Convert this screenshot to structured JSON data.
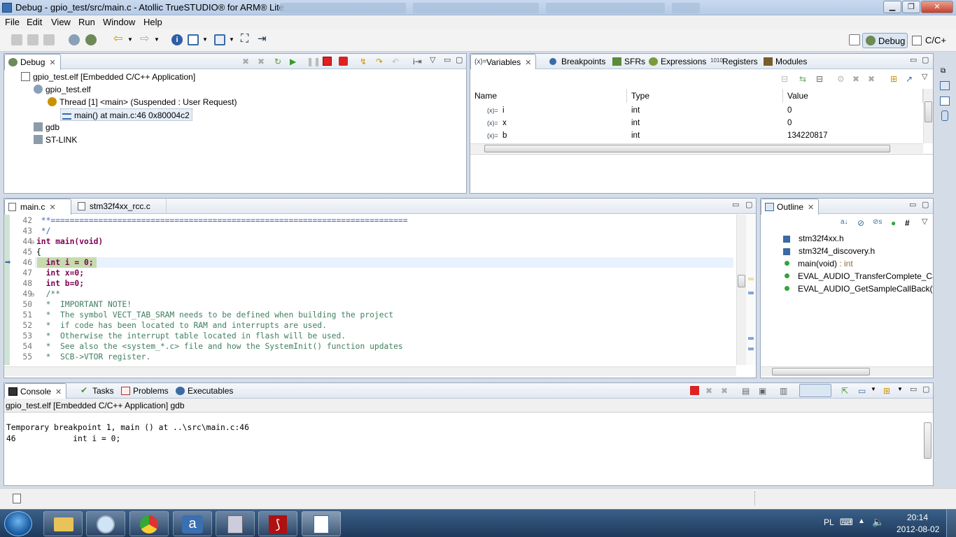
{
  "window": {
    "title": "Debug - gpio_test/src/main.c - Atollic TrueSTUDIO® for ARM® Lite"
  },
  "menu": [
    "File",
    "Edit",
    "View",
    "Run",
    "Window",
    "Help"
  ],
  "perspectives": {
    "debug": "Debug",
    "cc": "C/C+"
  },
  "debug_view": {
    "tab": "Debug",
    "tree": [
      "gpio_test.elf [Embedded C/C++ Application]",
      "gpio_test.elf",
      "Thread [1] <main> (Suspended : User Request)",
      "main() at main.c:46 0x80004c2",
      "gdb",
      "ST-LINK"
    ]
  },
  "variables_view": {
    "tabs": [
      "Variables",
      "Breakpoints",
      "SFRs",
      "Expressions",
      "Registers",
      "Modules"
    ],
    "columns": [
      "Name",
      "Type",
      "Value"
    ],
    "rows": [
      {
        "name": "i",
        "type": "int",
        "value": "0"
      },
      {
        "name": "x",
        "type": "int",
        "value": "0"
      },
      {
        "name": "b",
        "type": "int",
        "value": "134220817"
      }
    ]
  },
  "editor": {
    "tabs": [
      "main.c",
      "stm32f4xx_rcc.c"
    ],
    "lines": [
      {
        "n": "42",
        "t": " **==========================================================================="
      },
      {
        "n": "43",
        "t": " */"
      },
      {
        "n": "44",
        "t": "int main(void)"
      },
      {
        "n": "45",
        "t": "{"
      },
      {
        "n": "46",
        "t": "  int i = 0;"
      },
      {
        "n": "47",
        "t": "  int x=0;"
      },
      {
        "n": "48",
        "t": "  int b=0;"
      },
      {
        "n": "49",
        "t": "  /**"
      },
      {
        "n": "50",
        "t": "  *  IMPORTANT NOTE!"
      },
      {
        "n": "51",
        "t": "  *  The symbol VECT_TAB_SRAM needs to be defined when building the project"
      },
      {
        "n": "52",
        "t": "  *  if code has been located to RAM and interrupts are used."
      },
      {
        "n": "53",
        "t": "  *  Otherwise the interrupt table located in flash will be used."
      },
      {
        "n": "54",
        "t": "  *  See also the <system_*.c> file and how the SystemInit() function updates"
      },
      {
        "n": "55",
        "t": "  *  SCB->VTOR register."
      }
    ]
  },
  "outline_view": {
    "tab": "Outline",
    "items": [
      {
        "label": "stm32f4xx.h",
        "kind": "include"
      },
      {
        "label": "stm32f4_discovery.h",
        "kind": "include"
      },
      {
        "label": "main(void)",
        "suffix": " : int",
        "kind": "function"
      },
      {
        "label": "EVAL_AUDIO_TransferComplete_Cal",
        "kind": "function"
      },
      {
        "label": "EVAL_AUDIO_GetSampleCallBack(vo",
        "kind": "function"
      }
    ]
  },
  "console_view": {
    "tabs": [
      "Console",
      "Tasks",
      "Problems",
      "Executables"
    ],
    "process": "gpio_test.elf [Embedded C/C++ Application] gdb",
    "output": [
      "Temporary breakpoint 1, main () at ..\\src\\main.c:46",
      "46\t      int i = 0;"
    ]
  },
  "tray": {
    "lang": "PL",
    "time": "20:14",
    "date": "2012-08-02"
  },
  "colors": {
    "accent": "#3a6fb0",
    "current_line": "#e8f2fe",
    "keyword": "#7f0055",
    "comment": "#3f7f5f"
  }
}
